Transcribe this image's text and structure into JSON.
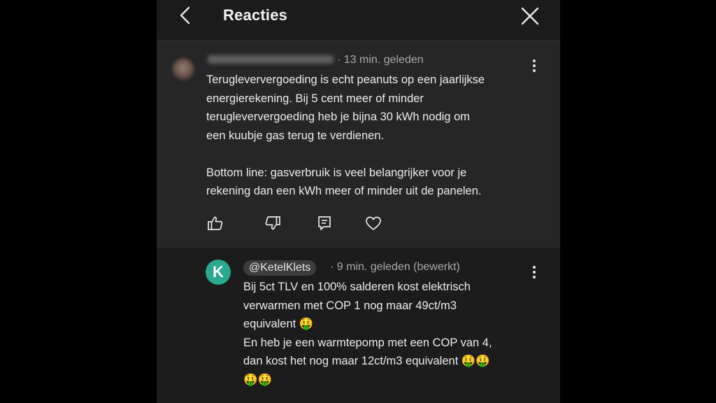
{
  "header": {
    "title": "Reacties"
  },
  "comment": {
    "timestamp": "· 13 min. geleden",
    "text": "Terugleververgoeding is echt peanuts op een jaarlijkse\nenergierekening. Bij 5 cent meer of minder\nterugleververgoeding heb je bijna 30 kWh nodig om\neen kuubje gas terug te verdienen.\n\nBottom line: gasverbruik is veel belangrijker voor je\nrekening dan een kWh meer of minder uit de panelen."
  },
  "reply": {
    "avatar_letter": "K",
    "handle": "@KetelKlets",
    "timestamp": "· 9 min. geleden (bewerkt)",
    "text": "Bij 5ct TLV en 100% salderen kost elektrisch\nverwarmen met COP 1 nog maar 49ct/m3\nequivalent 🤑\nEn heb je een warmtepomp met een COP van 4,\ndan kost het nog maar 12ct/m3 equivalent 🤑🤑\n🤑🤑"
  },
  "icons": {
    "back": "chevron-left-icon",
    "close": "close-icon",
    "like": "thumbs-up-icon",
    "dislike": "thumbs-down-icon",
    "reply": "reply-icon",
    "heart": "heart-icon",
    "more": "kebab-menu-icon"
  },
  "colors": {
    "background": "#1c1c1c",
    "comment_bg": "#262626",
    "text": "#ececec",
    "meta": "#a9a9a9",
    "avatar_accent": "#2aa98f"
  }
}
